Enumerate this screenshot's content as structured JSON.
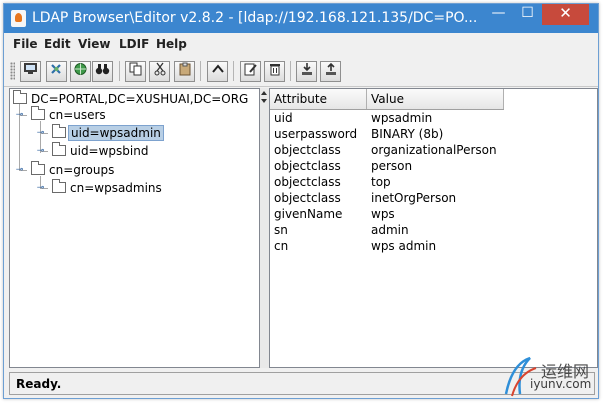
{
  "window": {
    "title": "LDAP Browser\\Editor v2.8.2 - [ldap://192.168.121.135/DC=PO...",
    "controls": {
      "minimize": "—",
      "maximize": "☐",
      "close": "✕"
    }
  },
  "menubar": {
    "items": [
      "File",
      "Edit",
      "View",
      "LDIF",
      "Help"
    ]
  },
  "toolbar": {
    "buttons": [
      {
        "name": "connect",
        "icon": "monitor-icon"
      },
      {
        "name": "refresh",
        "icon": "refresh-icon"
      },
      {
        "name": "disconnect",
        "icon": "globe-icon"
      },
      {
        "name": "search",
        "icon": "binoculars-icon"
      },
      {
        "name": "copy",
        "icon": "copy-icon"
      },
      {
        "name": "cut",
        "icon": "scissors-icon"
      },
      {
        "name": "paste",
        "icon": "clipboard-icon"
      },
      {
        "name": "up",
        "icon": "chevron-up-icon"
      },
      {
        "name": "edit",
        "icon": "edit-icon"
      },
      {
        "name": "delete",
        "icon": "trash-icon"
      },
      {
        "name": "import",
        "icon": "download-icon"
      },
      {
        "name": "export",
        "icon": "upload-icon"
      }
    ]
  },
  "tree": {
    "root": "DC=PORTAL,DC=XUSHUAI,DC=ORG",
    "nodes": [
      {
        "label": "cn=users",
        "expanded": true
      },
      {
        "label": "uid=wpsadmin",
        "selected": true
      },
      {
        "label": "uid=wpsbind"
      },
      {
        "label": "cn=groups",
        "expanded": true
      },
      {
        "label": "cn=wpsadmins"
      }
    ]
  },
  "table": {
    "columns": [
      "Attribute",
      "Value"
    ],
    "rows": [
      {
        "attribute": "uid",
        "value": "wpsadmin"
      },
      {
        "attribute": "userpassword",
        "value": "BINARY (8b)"
      },
      {
        "attribute": "objectclass",
        "value": "organizationalPerson"
      },
      {
        "attribute": "objectclass",
        "value": "person"
      },
      {
        "attribute": "objectclass",
        "value": "top"
      },
      {
        "attribute": "objectclass",
        "value": "inetOrgPerson"
      },
      {
        "attribute": "givenName",
        "value": "wps"
      },
      {
        "attribute": "sn",
        "value": "admin"
      },
      {
        "attribute": "cn",
        "value": "wps admin"
      }
    ]
  },
  "status": {
    "text": "Ready."
  },
  "watermark": {
    "line1": "运维网",
    "line2": "iyunv.com"
  },
  "colors": {
    "titlebar": "#3c86cf",
    "selection": "#b8cfe5",
    "close_button": "#c74a3c"
  }
}
